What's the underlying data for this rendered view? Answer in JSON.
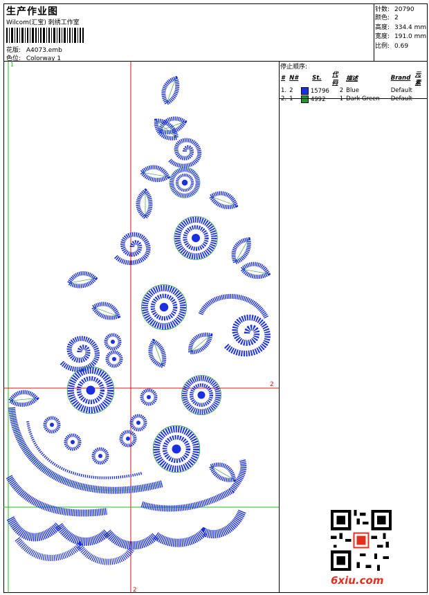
{
  "header": {
    "title": "生产作业图",
    "subtitle": "Wilcom(汇宝) 刺绣工作室",
    "design_label": "花版:",
    "design_value": "A4073.emb",
    "colorway_label": "色位:",
    "colorway_value": "Colorway 1"
  },
  "stats": [
    {
      "label": "针数:",
      "value": "20790"
    },
    {
      "label": "颜色:",
      "value": "2"
    },
    {
      "label": "高度:",
      "value": "334.4 mm"
    },
    {
      "label": "宽度:",
      "value": "191.0 mm"
    },
    {
      "label": "比例:",
      "value": "0.69"
    }
  ],
  "stop_sequence": {
    "title": "停止顺序:",
    "headers": [
      "#",
      "N#",
      "St.",
      "代码",
      "描述",
      "Brand",
      "元素"
    ],
    "rows": [
      {
        "idx": "1.",
        "n": "2",
        "color": "#1a2fe0",
        "stitches": "15796",
        "code": "2",
        "desc": "Blue",
        "brand": "Default"
      },
      {
        "idx": "2.",
        "n": "1",
        "color": "#1a9a28",
        "stitches": "4992",
        "code": "1",
        "desc": "Dark Green",
        "brand": "Default"
      }
    ]
  },
  "design": {
    "marker_top": "1",
    "marker_right": "2",
    "marker_bottom": "2",
    "stitch_color": "#1a2fe0",
    "outline_color": "#1a9a28",
    "guide_red": "#e01010",
    "guide_green": "#12c012"
  },
  "watermark": {
    "logo": "6xiu.com"
  }
}
